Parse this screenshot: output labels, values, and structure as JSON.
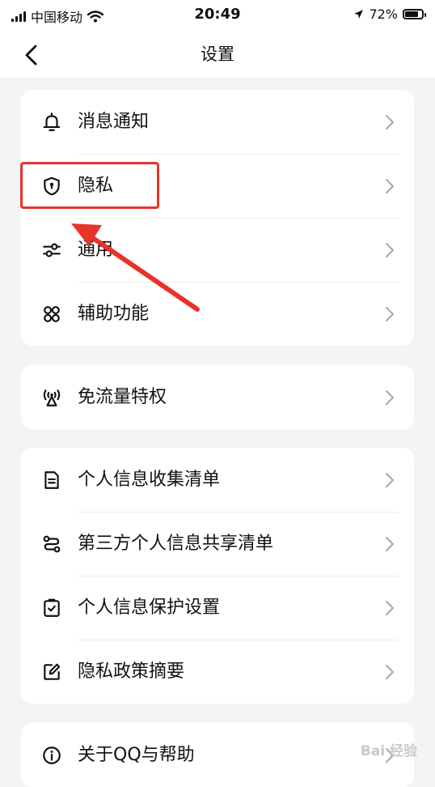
{
  "status_bar": {
    "carrier": "中国移动",
    "time": "20:49",
    "battery": "72%"
  },
  "nav": {
    "title": "设置"
  },
  "groups": [
    {
      "items": [
        {
          "label": "消息通知",
          "icon": "bell-icon"
        },
        {
          "label": "隐私",
          "icon": "shield-icon"
        },
        {
          "label": "通用",
          "icon": "sliders-icon"
        },
        {
          "label": "辅助功能",
          "icon": "grid-icon"
        }
      ]
    },
    {
      "items": [
        {
          "label": "免流量特权",
          "icon": "signal-tower-icon"
        }
      ]
    },
    {
      "items": [
        {
          "label": "个人信息收集清单",
          "icon": "document-icon"
        },
        {
          "label": "第三方个人信息共享清单",
          "icon": "share-icon"
        },
        {
          "label": "个人信息保护设置",
          "icon": "check-square-icon"
        },
        {
          "label": "隐私政策摘要",
          "icon": "edit-icon"
        }
      ]
    },
    {
      "items": [
        {
          "label": "关于QQ与帮助",
          "icon": "info-icon"
        }
      ]
    }
  ],
  "annotation": {
    "highlight_color": "#e8332a"
  },
  "watermark": "Bai 经验"
}
